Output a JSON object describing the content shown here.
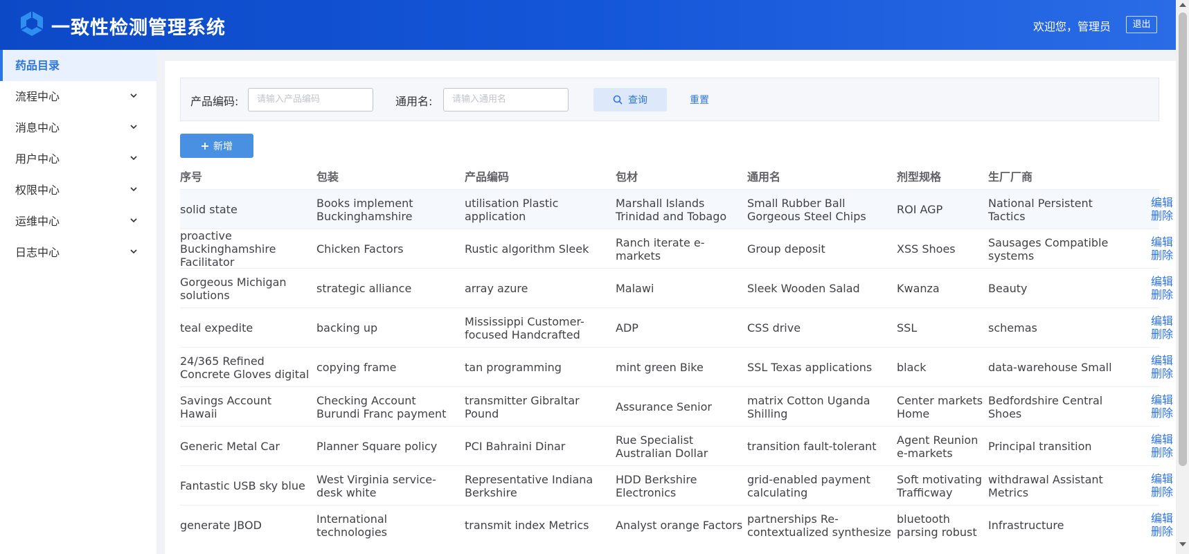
{
  "header": {
    "title": "一致性检测管理系统",
    "welcome": "欢迎您，管理员",
    "logout_label": "退出"
  },
  "sidebar": {
    "items": [
      {
        "label": "药品目录",
        "active": true,
        "expandable": false
      },
      {
        "label": "流程中心",
        "expandable": true
      },
      {
        "label": "消息中心",
        "expandable": true
      },
      {
        "label": "用户中心",
        "expandable": true
      },
      {
        "label": "权限中心",
        "expandable": true
      },
      {
        "label": "运维中心",
        "expandable": true
      },
      {
        "label": "日志中心",
        "expandable": true
      }
    ]
  },
  "search": {
    "code_label": "产品编码:",
    "code_placeholder": "请输入产品编码",
    "name_label": "通用名:",
    "name_placeholder": "请输入通用名",
    "query_label": "查询",
    "reset_label": "重置"
  },
  "toolbar": {
    "add_label": "新增"
  },
  "table": {
    "columns": [
      "序号",
      "包装",
      "产品编码",
      "包材",
      "通用名",
      "剂型规格",
      "生厂厂商"
    ],
    "edit_label": "编辑",
    "delete_label": "删除",
    "rows": [
      [
        "solid state",
        "Books implement Buckinghamshire",
        "utilisation Plastic application",
        "Marshall Islands Trinidad and Tobago",
        "Small Rubber Ball Gorgeous Steel Chips",
        "ROI AGP",
        "National Persistent Tactics"
      ],
      [
        "proactive Buckinghamshire Facilitator",
        "Chicken Factors",
        "Rustic algorithm Sleek",
        "Ranch iterate e-markets",
        "Group deposit",
        "XSS Shoes",
        "Sausages Compatible systems"
      ],
      [
        "Gorgeous Michigan solutions",
        "strategic alliance",
        "array azure",
        "Malawi",
        "Sleek Wooden Salad",
        "Kwanza",
        "Beauty"
      ],
      [
        "teal expedite",
        "backing up",
        "Mississippi Customer-focused Handcrafted",
        "ADP",
        "CSS drive",
        "SSL",
        "schemas"
      ],
      [
        "24/365 Refined Concrete Gloves digital",
        "copying frame",
        "tan programming",
        "mint green Bike",
        "SSL Texas applications",
        "black",
        "data-warehouse Small"
      ],
      [
        "Savings Account Hawaii",
        "Checking Account Burundi Franc payment",
        "transmitter Gibraltar Pound",
        "Assurance Senior",
        "matrix Cotton Uganda Shilling",
        "Center markets Home",
        "Bedfordshire Central Shoes"
      ],
      [
        "Generic Metal Car",
        "Planner Square policy",
        "PCI Bahraini Dinar",
        "Rue Specialist Australian Dollar",
        "transition fault-tolerant",
        "Agent Reunion e-markets",
        "Principal transition"
      ],
      [
        "Fantastic USB sky blue",
        "West Virginia service-desk white",
        "Representative Indiana Berkshire",
        "HDD Berkshire Electronics",
        "grid-enabled payment calculating",
        "Soft motivating Trafficway",
        "withdrawal Assistant Metrics"
      ],
      [
        "generate JBOD",
        "International technologies",
        "transmit index Metrics",
        "Analyst orange Factors",
        "partnerships Re-contextualized synthesize",
        "bluetooth parsing robust",
        "Infrastructure"
      ]
    ]
  },
  "colors": {
    "header_start": "#0c49c7",
    "header_end": "#2a6be6",
    "accent": "#2d75e6",
    "add_button": "#4a90e2"
  },
  "icons": {
    "logo": "cube-logo-icon",
    "chevron": "chevron-down-icon",
    "search": "search-icon",
    "plus": "plus-icon"
  }
}
